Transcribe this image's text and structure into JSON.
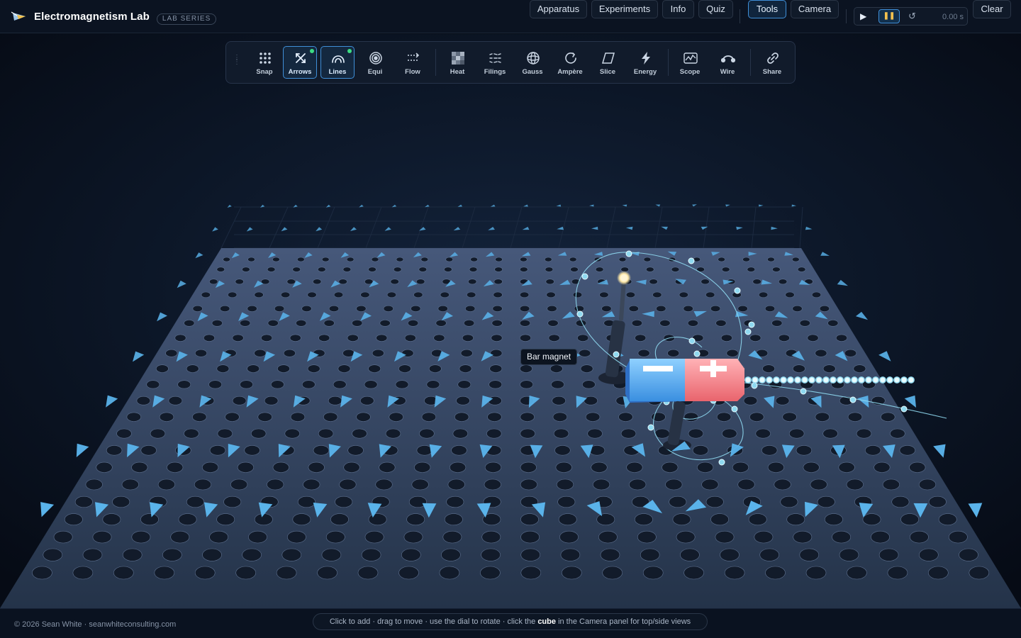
{
  "app": {
    "title": "Electromagnetism Lab",
    "badge": "LAB SERIES"
  },
  "nav": {
    "items": [
      {
        "label": "Apparatus",
        "active": false
      },
      {
        "label": "Experiments",
        "active": false
      },
      {
        "label": "Info",
        "active": false
      },
      {
        "label": "Quiz",
        "active": false
      },
      {
        "label": "Tools",
        "active": true
      },
      {
        "label": "Camera",
        "active": false
      }
    ],
    "clear_label": "Clear"
  },
  "player": {
    "play_icon": "play-icon",
    "pause_icon": "pause-icon",
    "reset_icon": "reset-icon",
    "time": "0.00 s"
  },
  "toolbar": {
    "tools": [
      {
        "label": "Snap",
        "icon": "grid-dots-icon",
        "active": false
      },
      {
        "label": "Arrows",
        "icon": "arrows-icon",
        "active": true
      },
      {
        "label": "Lines",
        "icon": "field-lines-icon",
        "active": true
      },
      {
        "label": "Equi",
        "icon": "equipotential-icon",
        "active": false
      },
      {
        "label": "Flow",
        "icon": "flow-icon",
        "active": false
      },
      {
        "label": "Heat",
        "icon": "heatmap-icon",
        "active": false
      },
      {
        "label": "Filings",
        "icon": "filings-icon",
        "active": false
      },
      {
        "label": "Gauss",
        "icon": "gauss-sphere-icon",
        "active": false
      },
      {
        "label": "Ampère",
        "icon": "ampere-loop-icon",
        "active": false
      },
      {
        "label": "Slice",
        "icon": "slice-plane-icon",
        "active": false
      },
      {
        "label": "Energy",
        "icon": "lightning-icon",
        "active": false
      },
      {
        "label": "Scope",
        "icon": "oscilloscope-icon",
        "active": false
      },
      {
        "label": "Wire",
        "icon": "wire-icon",
        "active": false
      },
      {
        "label": "Share",
        "icon": "link-icon",
        "active": false
      }
    ]
  },
  "scene": {
    "tooltip": "Bar magnet",
    "magnet": {
      "north_symbol": "−",
      "south_symbol": "+",
      "north_color": "#5fb8ff",
      "south_color": "#ff7f86"
    },
    "arrow_color": "#5ab3ea",
    "field_line_color": "#8fd9f0",
    "probe_color": "#ffe9a8"
  },
  "footer": {
    "copyright": "© 2026 Sean White · seanwhiteconsulting.com",
    "hint_before": "Click to add · drag to move · use the dial to rotate · click the",
    "hint_bold": "cube",
    "hint_after": "in the Camera panel for top/side views"
  }
}
